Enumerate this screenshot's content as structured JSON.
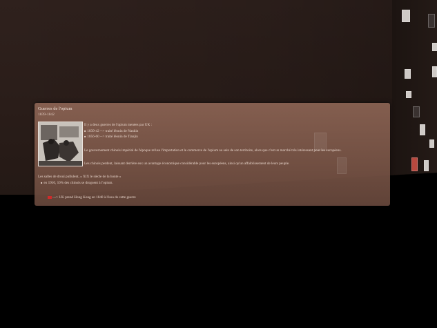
{
  "panel": {
    "title": "Guerres de l'opium",
    "dates": "1839-1842",
    "intro": "Il y a deux guerres de l'opium menées par UK :",
    "wars": [
      "1839-42 --> traité léonin de Nankin",
      "1856-60 --> traité léonin de Tianjin"
    ],
    "para1": "Le gouvernement chinois impérial de l'époque refuse l'importation et le commerce de l'opium au sein de son territoire, alors que c'est un marché très intéressant pour les européens.",
    "para2": "Les chinois perdent, laissant derrière eux un avantage économique considérable pour les européens, ainsi qu'un affaiblissement de leurs peuple.",
    "para3": "Les salles de drouí pullulent, « XIX le siècle de la honte »",
    "para3_bullet": "en 1910, 10% des chinois se droguent à l'opium.",
    "footer": "---> UK prend Hong Kong en 1840 à l'issu de cette guerre"
  },
  "icons": {
    "photo": "opium-den-photo",
    "flag": "uk-flag-icon"
  },
  "colors": {
    "panel": "#8c6454",
    "background": "#2c1f1b",
    "floor": "#000000"
  }
}
